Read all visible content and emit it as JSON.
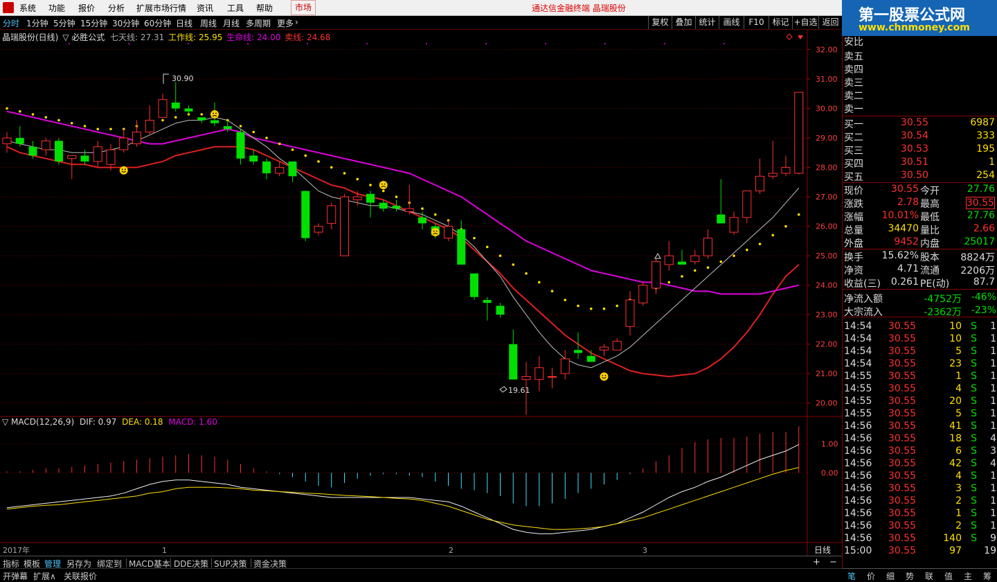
{
  "menu": {
    "items": [
      "系统",
      "功能",
      "报价",
      "分析",
      "扩展市场行情",
      "资讯",
      "工具",
      "帮助"
    ],
    "market_tab": "市场",
    "brand_text": "通达信金融终端  晶瑞股份"
  },
  "logo": {
    "line1": "第一股票公式网",
    "line2": "www.chnmoney.com"
  },
  "toolbar": {
    "periods": [
      "分时",
      "1分钟",
      "5分钟",
      "15分钟",
      "30分钟",
      "60分钟",
      "日线",
      "周线",
      "月线",
      "多周期",
      "更多"
    ],
    "active_period": "分时",
    "right_buttons": [
      "复权",
      "叠加",
      "统计",
      "画线",
      "F10",
      "标记",
      "+自选",
      "返回"
    ]
  },
  "indicator": {
    "stock_label": "晶瑞股份(日线)",
    "formula_label": "▽ 必胜公式",
    "ma7_label": "七天线: 27.31",
    "work_label": "工作线: 25.95",
    "life_label": "生命线: 24.00",
    "sell_label": "卖线: 24.68",
    "high_label": "30.90",
    "low_label": "19.61"
  },
  "colors": {
    "up": "#ff3030",
    "down": "#00e000",
    "work_line": "#e000e0",
    "life_line": "#e02020",
    "ma7_line": "#c0c0c0",
    "dots": "#ffe000",
    "grid": "#7a0000"
  },
  "price_axis": {
    "ticks": [
      "32.00",
      "31.00",
      "30.00",
      "29.00",
      "28.00",
      "27.00",
      "26.00",
      "25.00",
      "24.00",
      "23.00",
      "22.00",
      "21.00",
      "20.00"
    ]
  },
  "macd": {
    "label": "▽ MACD(12,26,9)",
    "dif_label": "DIF: 0.97",
    "dea_label": "DEA: 0.18",
    "macd_label": "MACD: 1.60",
    "axis_ticks": [
      "1.00",
      "0.00"
    ]
  },
  "date_axis": {
    "labels": [
      "2017年",
      "1",
      "2",
      "3"
    ],
    "period_label": "日线"
  },
  "bottom_tabs": [
    "指标",
    "模板",
    "管理",
    "另存为",
    "绑定到",
    "MACD基本",
    "DDE决策",
    "SUP决策",
    "资金决策"
  ],
  "bottom_active": "管理",
  "status_items": [
    "开弹幕",
    "扩展∧",
    "关联报价"
  ],
  "chart_data": {
    "type": "candlestick",
    "ylim": [
      19.5,
      32.2
    ],
    "candles": [
      [
        28.8,
        29.2,
        28.5,
        29.0
      ],
      [
        29.0,
        29.4,
        28.7,
        28.8
      ],
      [
        28.7,
        28.9,
        28.3,
        28.4
      ],
      [
        28.6,
        29.0,
        28.4,
        28.9
      ],
      [
        28.9,
        29.0,
        28.1,
        28.2
      ],
      [
        28.3,
        28.4,
        27.6,
        28.4
      ],
      [
        28.4,
        28.6,
        28.1,
        28.2
      ],
      [
        28.2,
        28.9,
        28.0,
        28.7
      ],
      [
        28.1,
        28.8,
        27.9,
        28.6
      ],
      [
        28.6,
        29.3,
        28.5,
        29.0
      ],
      [
        28.8,
        29.6,
        28.7,
        29.2
      ],
      [
        29.2,
        30.1,
        29.1,
        29.6
      ],
      [
        29.7,
        30.5,
        29.7,
        30.3
      ],
      [
        30.2,
        30.9,
        29.9,
        30.0
      ],
      [
        30.0,
        30.1,
        29.8,
        29.9
      ],
      [
        29.7,
        29.7,
        29.5,
        29.6
      ],
      [
        29.6,
        30.2,
        29.4,
        29.5
      ],
      [
        29.4,
        29.6,
        29.2,
        29.3
      ],
      [
        29.2,
        29.3,
        28.1,
        28.3
      ],
      [
        28.4,
        28.6,
        28.1,
        28.2
      ],
      [
        28.2,
        28.3,
        27.6,
        27.8
      ],
      [
        27.8,
        28.2,
        27.7,
        28.0
      ],
      [
        28.2,
        28.2,
        27.5,
        27.7
      ],
      [
        27.2,
        27.2,
        25.5,
        25.6
      ],
      [
        25.8,
        26.1,
        25.7,
        26.0
      ],
      [
        26.1,
        26.8,
        25.9,
        26.7
      ],
      [
        25.0,
        27.1,
        25.0,
        27.0
      ],
      [
        26.9,
        27.2,
        26.7,
        27.0
      ],
      [
        27.1,
        27.2,
        26.3,
        26.8
      ],
      [
        26.8,
        26.9,
        26.5,
        26.6
      ],
      [
        26.7,
        26.9,
        26.5,
        26.6
      ],
      [
        26.5,
        27.4,
        26.4,
        26.6
      ],
      [
        26.3,
        26.5,
        25.9,
        26.1
      ],
      [
        26.0,
        26.1,
        25.6,
        25.7
      ],
      [
        25.6,
        26.2,
        25.5,
        26.0
      ],
      [
        25.9,
        26.2,
        24.8,
        24.7
      ],
      [
        24.4,
        24.4,
        23.5,
        23.6
      ],
      [
        23.5,
        23.6,
        22.8,
        23.4
      ],
      [
        23.3,
        23.4,
        22.9,
        23.0
      ],
      [
        22.0,
        22.5,
        21.0,
        20.8
      ],
      [
        20.8,
        21.4,
        19.6,
        20.9
      ],
      [
        20.8,
        21.6,
        20.4,
        21.2
      ],
      [
        20.9,
        21.2,
        20.5,
        20.9
      ],
      [
        21.0,
        21.8,
        20.8,
        21.5
      ],
      [
        21.8,
        22.4,
        21.5,
        21.7
      ],
      [
        21.6,
        21.8,
        21.4,
        21.4
      ],
      [
        21.8,
        22.0,
        21.6,
        21.9
      ],
      [
        21.8,
        22.2,
        21.8,
        22.1
      ],
      [
        22.6,
        23.8,
        22.3,
        23.5
      ],
      [
        23.4,
        24.1,
        23.3,
        24.0
      ],
      [
        23.9,
        24.9,
        23.7,
        24.8
      ],
      [
        24.7,
        25.5,
        24.5,
        25.0
      ],
      [
        24.8,
        25.2,
        24.8,
        24.7
      ],
      [
        24.8,
        25.2,
        24.7,
        25.0
      ],
      [
        25.0,
        25.9,
        24.9,
        25.6
      ],
      [
        26.4,
        27.6,
        26.4,
        26.1
      ],
      [
        25.8,
        26.5,
        25.7,
        26.3
      ],
      [
        26.3,
        27.1,
        26.1,
        27.2
      ],
      [
        27.2,
        28.3,
        27.1,
        27.7
      ],
      [
        27.7,
        28.9,
        27.6,
        27.8
      ],
      [
        27.8,
        28.4,
        27.7,
        28.0
      ],
      [
        27.8,
        30.55,
        27.76,
        30.55
      ]
    ],
    "ma7": [
      28.9,
      28.8,
      28.7,
      28.6,
      28.6,
      28.5,
      28.5,
      28.5,
      28.6,
      28.7,
      28.9,
      29.1,
      29.3,
      29.5,
      29.6,
      29.6,
      29.7,
      29.6,
      29.3,
      29.0,
      28.7,
      28.3,
      28.0,
      27.6,
      27.2,
      27.0,
      26.9,
      26.8,
      26.7,
      26.7,
      26.6,
      26.5,
      26.4,
      26.2,
      26.0,
      25.7,
      25.3,
      24.8,
      24.3,
      23.6,
      23.0,
      22.4,
      21.9,
      21.5,
      21.3,
      21.2,
      21.4,
      21.6,
      21.9,
      22.3,
      22.7,
      23.1,
      23.5,
      23.9,
      24.3,
      24.7,
      25.1,
      25.5,
      25.9,
      26.3,
      26.8,
      27.3
    ],
    "life_line": [
      28.7,
      28.5,
      28.4,
      28.3,
      28.2,
      28.1,
      28.1,
      28.0,
      28.0,
      28.0,
      28.0,
      28.1,
      28.2,
      28.4,
      28.5,
      28.6,
      28.7,
      28.7,
      28.7,
      28.6,
      28.4,
      28.2,
      28.0,
      27.8,
      27.6,
      27.4,
      27.3,
      27.1,
      27.0,
      26.9,
      26.7,
      26.5,
      26.3,
      26.1,
      25.9,
      25.6,
      25.2,
      24.8,
      24.4,
      23.9,
      23.5,
      23.1,
      22.7,
      22.3,
      22.0,
      21.7,
      21.5,
      21.3,
      21.1,
      21.0,
      20.95,
      20.9,
      20.95,
      21.0,
      21.2,
      21.5,
      21.9,
      22.4,
      23.0,
      23.7,
      24.3,
      24.7
    ],
    "work_line": [
      29.9,
      29.8,
      29.7,
      29.6,
      29.5,
      29.4,
      29.3,
      29.2,
      29.1,
      29.0,
      28.9,
      28.8,
      28.8,
      28.9,
      29.0,
      29.1,
      29.2,
      29.3,
      29.2,
      29.0,
      28.9,
      28.8,
      28.7,
      28.6,
      28.5,
      28.4,
      28.3,
      28.2,
      28.1,
      28.0,
      27.9,
      27.8,
      27.6,
      27.4,
      27.2,
      27.0,
      26.7,
      26.4,
      26.1,
      25.8,
      25.5,
      25.3,
      25.1,
      24.9,
      24.7,
      24.5,
      24.4,
      24.3,
      24.2,
      24.1,
      24.1,
      24.0,
      23.9,
      23.8,
      23.8,
      23.7,
      23.7,
      23.7,
      23.7,
      23.8,
      23.9,
      24.0
    ],
    "dots": [
      30.0,
      29.9,
      29.8,
      29.7,
      29.6,
      29.5,
      29.4,
      29.3,
      29.3,
      29.3,
      29.4,
      29.5,
      29.6,
      29.7,
      29.8,
      29.8,
      29.8,
      29.6,
      29.4,
      29.2,
      29.0,
      28.8,
      28.6,
      28.4,
      28.2,
      28.0,
      27.8,
      27.6,
      27.4,
      27.2,
      27.0,
      26.8,
      26.6,
      26.4,
      26.2,
      25.9,
      25.6,
      25.3,
      25.0,
      24.7,
      24.4,
      24.1,
      23.8,
      23.5,
      23.3,
      23.2,
      23.2,
      23.3,
      23.5,
      23.7,
      23.9,
      24.1,
      24.3,
      24.5,
      24.6,
      24.8,
      25.0,
      25.2,
      25.4,
      25.7,
      26.0,
      26.4
    ],
    "macd_hist": [
      0.05,
      0.05,
      0.1,
      0.15,
      0.15,
      0.2,
      0.25,
      0.3,
      0.35,
      0.4,
      0.45,
      0.5,
      0.55,
      0.6,
      0.65,
      0.6,
      0.55,
      0.45,
      0.3,
      0.15,
      0.05,
      -0.05,
      -0.15,
      -0.3,
      -0.45,
      -0.5,
      -0.35,
      -0.2,
      -0.1,
      -0.05,
      -0.05,
      -0.1,
      -0.15,
      -0.3,
      -0.45,
      -0.55,
      -0.6,
      -0.7,
      -0.8,
      -1.05,
      -1.15,
      -1.15,
      -1.05,
      -0.9,
      -0.7,
      -0.55,
      -0.4,
      -0.25,
      -0.05,
      0.15,
      0.4,
      0.6,
      0.85,
      1.05,
      1.15,
      1.2,
      1.2,
      1.25,
      1.35,
      1.4,
      1.4,
      1.6
    ],
    "dif": [
      -1.2,
      -1.15,
      -1.1,
      -1.05,
      -1.0,
      -0.95,
      -0.9,
      -0.85,
      -0.8,
      -0.7,
      -0.55,
      -0.4,
      -0.3,
      -0.25,
      -0.25,
      -0.3,
      -0.35,
      -0.4,
      -0.5,
      -0.55,
      -0.6,
      -0.65,
      -0.7,
      -0.75,
      -0.8,
      -0.85,
      -0.85,
      -0.85,
      -0.85,
      -0.85,
      -0.85,
      -0.85,
      -0.9,
      -0.95,
      -1.0,
      -1.15,
      -1.35,
      -1.55,
      -1.75,
      -1.95,
      -2.05,
      -2.1,
      -2.1,
      -2.05,
      -2.0,
      -1.95,
      -1.85,
      -1.75,
      -1.55,
      -1.35,
      -1.1,
      -0.85,
      -0.65,
      -0.5,
      -0.3,
      -0.15,
      0.05,
      0.25,
      0.45,
      0.6,
      0.75,
      0.97
    ],
    "dea": [
      -1.25,
      -1.2,
      -1.15,
      -1.12,
      -1.1,
      -1.05,
      -1.0,
      -0.95,
      -0.9,
      -0.85,
      -0.8,
      -0.7,
      -0.65,
      -0.55,
      -0.5,
      -0.5,
      -0.5,
      -0.52,
      -0.55,
      -0.6,
      -0.62,
      -0.65,
      -0.67,
      -0.7,
      -0.72,
      -0.75,
      -0.78,
      -0.8,
      -0.82,
      -0.85,
      -0.88,
      -0.9,
      -0.95,
      -1.05,
      -1.15,
      -1.3,
      -1.45,
      -1.6,
      -1.7,
      -1.8,
      -1.85,
      -1.9,
      -1.95,
      -1.95,
      -1.93,
      -1.9,
      -1.85,
      -1.75,
      -1.65,
      -1.55,
      -1.4,
      -1.25,
      -1.1,
      -0.95,
      -0.8,
      -0.65,
      -0.5,
      -0.35,
      -0.2,
      -0.05,
      0.08,
      0.18
    ],
    "macd_ylim": [
      -2.4,
      1.7
    ]
  },
  "quote": {
    "asks": [
      {
        "label": "卖五"
      },
      {
        "label": "卖四"
      },
      {
        "label": "卖三"
      },
      {
        "label": "卖二"
      },
      {
        "label": "卖一"
      }
    ],
    "bids": [
      {
        "label": "买一",
        "price": "30.55",
        "vol": "6987"
      },
      {
        "label": "买二",
        "price": "30.54",
        "vol": "333"
      },
      {
        "label": "买三",
        "price": "30.53",
        "vol": "195"
      },
      {
        "label": "买四",
        "price": "30.51",
        "vol": "1"
      },
      {
        "label": "买五",
        "price": "30.50",
        "vol": "254"
      }
    ],
    "stats": [
      {
        "l1": "现价",
        "v1": "30.55",
        "c1": "#ff3030",
        "l2": "今开",
        "v2": "27.76",
        "c2": "#00e000"
      },
      {
        "l1": "涨跌",
        "v1": "2.78",
        "c1": "#ff3030",
        "l2": "最高",
        "v2": "30.55",
        "c2": "#ff3030"
      },
      {
        "l1": "涨幅",
        "v1": "10.01%",
        "c1": "#ff3030",
        "l2": "最低",
        "v2": "27.76",
        "c2": "#00e000"
      },
      {
        "l1": "总量",
        "v1": "34470",
        "c1": "#ffe000",
        "l2": "量比",
        "v2": "2.66",
        "c2": "#ff3030"
      },
      {
        "l1": "外盘",
        "v1": "9452",
        "c1": "#ff3030",
        "l2": "内盘",
        "v2": "25017",
        "c2": "#00e000"
      }
    ],
    "fund": [
      {
        "l1": "换手",
        "v1": "15.62%",
        "c1": "#ddd",
        "l2": "股本",
        "v2": "8824万",
        "c2": "#ddd"
      },
      {
        "l1": "净资",
        "v1": "4.71",
        "c1": "#ddd",
        "l2": "流通",
        "v2": "2206万",
        "c2": "#ddd"
      },
      {
        "l1": "收益(三)",
        "v1": "0.261",
        "c1": "#ddd",
        "l2": "PE(动)",
        "v2": "87.7",
        "c2": "#ddd"
      }
    ],
    "flow": [
      {
        "label": "净流入额",
        "value": "-4752万",
        "pct": "-46%"
      },
      {
        "label": "大宗流入",
        "value": "-2362万",
        "pct": "-23%"
      }
    ],
    "ticks": [
      [
        "14:54",
        "30.55",
        "10",
        "S",
        "1"
      ],
      [
        "14:54",
        "30.55",
        "10",
        "S",
        "1"
      ],
      [
        "14:54",
        "30.55",
        "5",
        "S",
        "1"
      ],
      [
        "14:54",
        "30.55",
        "23",
        "S",
        "1"
      ],
      [
        "14:55",
        "30.55",
        "1",
        "S",
        "1"
      ],
      [
        "14:55",
        "30.55",
        "4",
        "S",
        "1"
      ],
      [
        "14:55",
        "30.55",
        "20",
        "S",
        "1"
      ],
      [
        "14:55",
        "30.55",
        "5",
        "S",
        "1"
      ],
      [
        "14:56",
        "30.55",
        "41",
        "S",
        "1"
      ],
      [
        "14:56",
        "30.55",
        "18",
        "S",
        "4"
      ],
      [
        "14:56",
        "30.55",
        "6",
        "S",
        "3"
      ],
      [
        "14:56",
        "30.55",
        "42",
        "S",
        "4"
      ],
      [
        "14:56",
        "30.55",
        "4",
        "S",
        "1"
      ],
      [
        "14:56",
        "30.55",
        "3",
        "S",
        "1"
      ],
      [
        "14:56",
        "30.55",
        "2",
        "S",
        "1"
      ],
      [
        "14:56",
        "30.55",
        "1",
        "S",
        "1"
      ],
      [
        "14:56",
        "30.55",
        "2",
        "S",
        "1"
      ],
      [
        "14:56",
        "30.55",
        "140",
        "S",
        "9"
      ],
      [
        "15:00",
        "30.55",
        "97",
        "",
        "19"
      ]
    ],
    "top_partial": "安比"
  },
  "side_tabs": [
    "笔",
    "价",
    "细",
    "势",
    "联",
    "值",
    "主",
    "筹"
  ]
}
